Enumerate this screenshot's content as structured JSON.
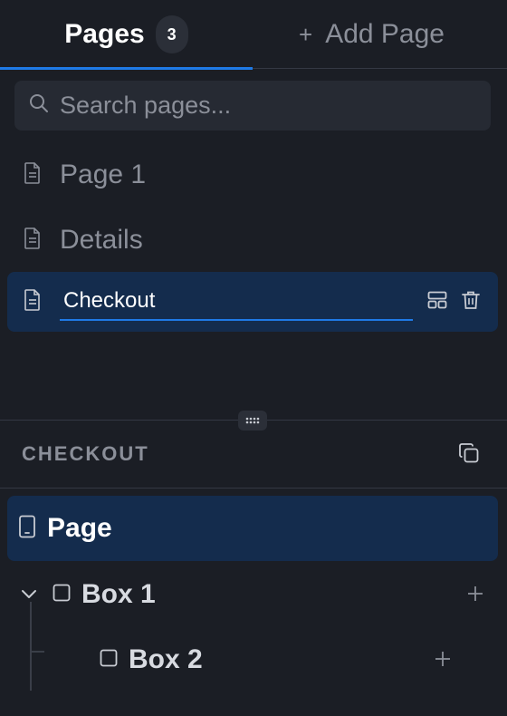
{
  "tabs": {
    "pages_label": "Pages",
    "pages_count": "3",
    "add_page_label": "Add Page"
  },
  "search": {
    "placeholder": "Search pages..."
  },
  "pages": [
    {
      "title": "Page 1"
    },
    {
      "title": "Details"
    },
    {
      "title": "Checkout",
      "active": true
    }
  ],
  "section": {
    "title": "CHECKOUT"
  },
  "tree": {
    "root_label": "Page",
    "children": [
      {
        "label": "Box 1"
      },
      {
        "label": "Box 2"
      }
    ]
  },
  "colors": {
    "accent": "#1f7ae6",
    "active_bg": "#142c4d",
    "background": "#1b1e25"
  },
  "icons": {
    "search": "search-icon",
    "page": "page-document-icon",
    "layout": "layout-icon",
    "trash": "trash-icon",
    "copy": "copy-icon",
    "device": "phone-device-icon",
    "box": "box-icon",
    "chevron": "chevron-down-icon",
    "plus": "plus-icon"
  }
}
